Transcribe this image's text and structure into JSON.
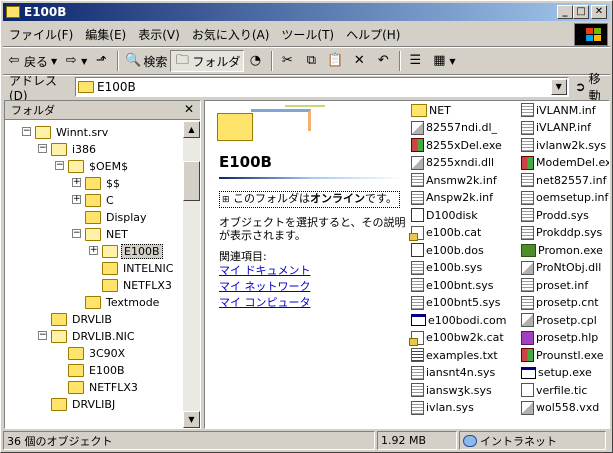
{
  "window": {
    "title": "E100B"
  },
  "menu": [
    "ファイル(F)",
    "編集(E)",
    "表示(V)",
    "お気に入り(A)",
    "ツール(T)",
    "ヘルプ(H)"
  ],
  "toolbar": {
    "back": "戻る",
    "forward": "→",
    "search": "検索",
    "folders": "フォルダ"
  },
  "address": {
    "label": "アドレス(D)",
    "value": "E100B",
    "go": "移動"
  },
  "leftpane": {
    "title": "フォルダ"
  },
  "tree": [
    {
      "label": "Winnt.srv"
    },
    {
      "label": "i386"
    },
    {
      "label": "$OEM$"
    },
    {
      "label": "$$"
    },
    {
      "label": "C"
    },
    {
      "label": "Display"
    },
    {
      "label": "NET"
    },
    {
      "label": "E100B"
    },
    {
      "label": "INTELNIC"
    },
    {
      "label": "NETFLX3"
    },
    {
      "label": "Textmode"
    },
    {
      "label": "DRVLIB"
    },
    {
      "label": "DRVLIB.NIC"
    },
    {
      "label": "3C90X"
    },
    {
      "label": "E100B"
    },
    {
      "label": "NETFLX3"
    },
    {
      "label": "DRVLIBJ"
    }
  ],
  "banner": {
    "title": "E100B",
    "online_prefix": "このフォルダは",
    "online_bold": "オンライン",
    "online_suffix": "です。",
    "desc": "オブジェクトを選択すると、その説明が表示されます。",
    "related": "関連項目:",
    "links": [
      "マイ ドキュメント",
      "マイ ネットワーク",
      "マイ コンピュータ"
    ]
  },
  "files_col1": [
    {
      "name": "NET",
      "icon": "folder"
    },
    {
      "name": "82557ndi.dl_",
      "icon": "dll"
    },
    {
      "name": "8255xDel.exe",
      "icon": "red"
    },
    {
      "name": "8255xndi.dll",
      "icon": "dll"
    },
    {
      "name": "Ansmw2k.inf",
      "icon": "sys"
    },
    {
      "name": "Anspw2k.inf",
      "icon": "sys"
    },
    {
      "name": "D100disk",
      "icon": "dos"
    },
    {
      "name": "e100b.cat",
      "icon": "cat"
    },
    {
      "name": "e100b.dos",
      "icon": "dos"
    },
    {
      "name": "e100b.sys",
      "icon": "sys"
    },
    {
      "name": "e100bnt.sys",
      "icon": "sys"
    },
    {
      "name": "e100bnt5.sys",
      "icon": "sys"
    },
    {
      "name": "e100bodi.com",
      "icon": "com"
    },
    {
      "name": "e100bw2k.cat",
      "icon": "cat"
    },
    {
      "name": "examples.txt",
      "icon": "txt"
    },
    {
      "name": "iansnt4n.sys",
      "icon": "sys"
    },
    {
      "name": "ianswʒk.sys",
      "icon": "sys"
    },
    {
      "name": "ivlan.sys",
      "icon": "sys"
    }
  ],
  "files_col2": [
    {
      "name": "iVLANM.inf",
      "icon": "sys"
    },
    {
      "name": "iVLANP.inf",
      "icon": "sys"
    },
    {
      "name": "ivlanw2k.sys",
      "icon": "sys"
    },
    {
      "name": "ModemDel.exe",
      "icon": "red"
    },
    {
      "name": "net82557.inf",
      "icon": "sys"
    },
    {
      "name": "oemsetup.inf",
      "icon": "sys"
    },
    {
      "name": "Prodd.sys",
      "icon": "sys"
    },
    {
      "name": "Prokddp.sys",
      "icon": "sys"
    },
    {
      "name": "Promon.exe",
      "icon": "exe"
    },
    {
      "name": "ProNtObj.dll",
      "icon": "dll"
    },
    {
      "name": "proset.inf",
      "icon": "sys"
    },
    {
      "name": "prosetp.cnt",
      "icon": "sys"
    },
    {
      "name": "Prosetp.cpl",
      "icon": "dll"
    },
    {
      "name": "prosetp.hlp",
      "icon": "hlp"
    },
    {
      "name": "Prounstl.exe",
      "icon": "red"
    },
    {
      "name": "setup.exe",
      "icon": "com"
    },
    {
      "name": "verfile.tic",
      "icon": "tic"
    },
    {
      "name": "wol558.vxd",
      "icon": "dll"
    }
  ],
  "status": {
    "count": "36 個のオブジェクト",
    "size": "1.92 MB",
    "zone": "イントラネット"
  }
}
